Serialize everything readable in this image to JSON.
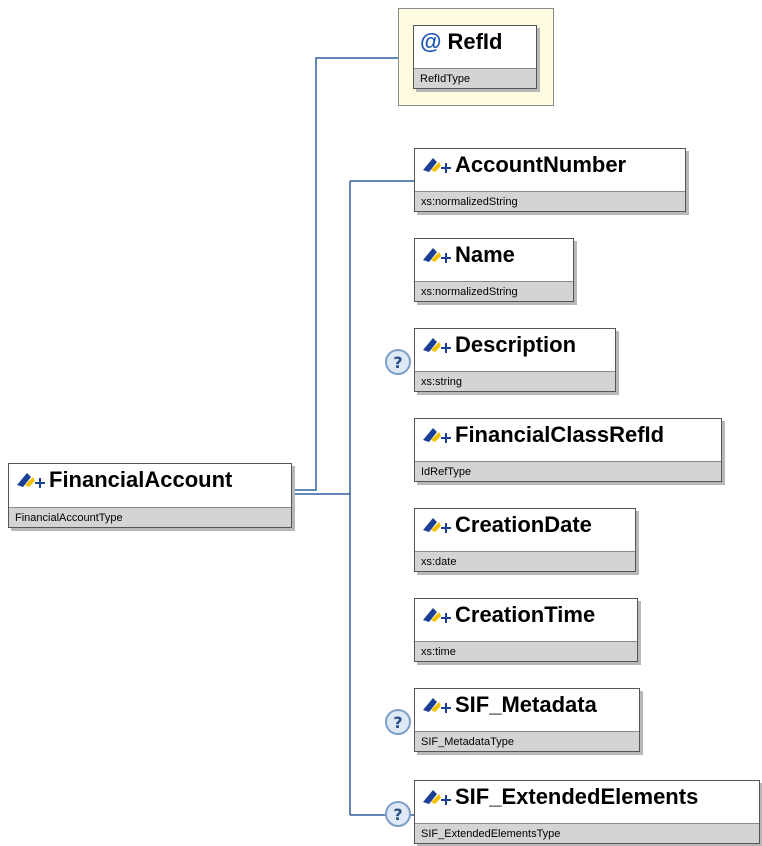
{
  "root": {
    "name": "FinancialAccount",
    "type": "FinancialAccountType"
  },
  "attribute": {
    "name": "RefId",
    "type": "RefIdType",
    "icon": "at-sign-icon"
  },
  "elements": [
    {
      "name": "AccountNumber",
      "type": "xs:normalizedString",
      "optional": false
    },
    {
      "name": "Name",
      "type": "xs:normalizedString",
      "optional": false
    },
    {
      "name": "Description",
      "type": "xs:string",
      "optional": true
    },
    {
      "name": "FinancialClassRefId",
      "type": "IdRefType",
      "optional": false
    },
    {
      "name": "CreationDate",
      "type": "xs:date",
      "optional": false
    },
    {
      "name": "CreationTime",
      "type": "xs:time",
      "optional": false
    },
    {
      "name": "SIF_Metadata",
      "type": "SIF_MetadataType",
      "optional": true
    },
    {
      "name": "SIF_ExtendedElements",
      "type": "SIF_ExtendedElementsType",
      "optional": true
    }
  ],
  "colors": {
    "connector": "#2e5f9e",
    "type_bar": "#d4d4d4",
    "attribute_background": "#fffbe0",
    "optional_icon": "#7d9fc9"
  }
}
